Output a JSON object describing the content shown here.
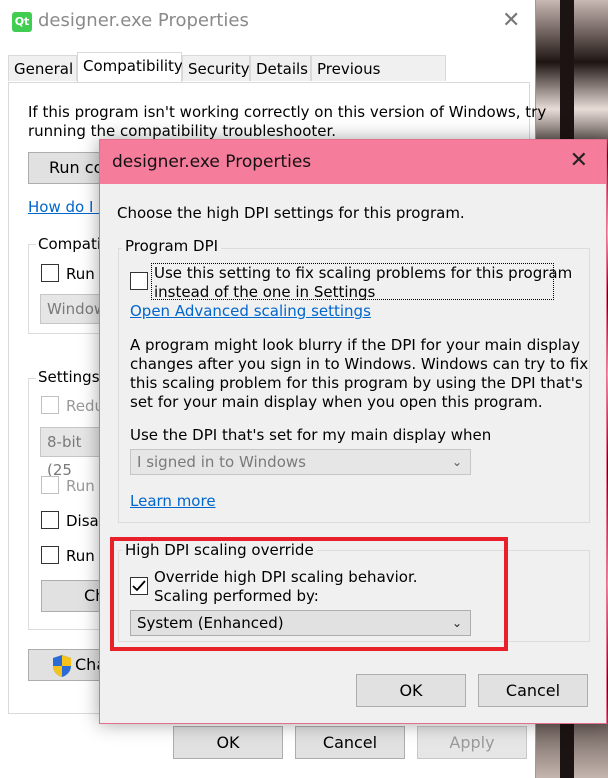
{
  "main_window": {
    "title": "designer.exe Properties",
    "icon_label": "Qt",
    "close_glyph": "✕",
    "tabs": [
      "General",
      "Compatibility",
      "Security",
      "Details",
      "Previous Versions"
    ],
    "intro_line1": "If this program isn't working correctly on this version of Windows, try",
    "intro_line2": "running the compatibility troubleshooter.",
    "run_button": "Run co",
    "how_link": "How do I c",
    "compat_group": "Compatib",
    "run_chk": "Run",
    "windows_combo": "Window",
    "settings_group": "Settings",
    "reduced_chk": "Redu",
    "color_combo": "8-bit (25",
    "run_chk2": "Run",
    "disable_chk": "Disal",
    "run_chk3": "Run",
    "change_btn": "Ch",
    "change_all_btn": "Cha",
    "ok": "OK",
    "cancel": "Cancel",
    "apply": "Apply"
  },
  "dialog": {
    "title": "designer.exe Properties",
    "close_glyph": "✕",
    "instruction": "Choose the high DPI settings for this program.",
    "program_dpi": {
      "legend": "Program DPI",
      "checkbox_line1": "Use this setting to fix scaling problems for this program",
      "checkbox_line2": "instead of the one in Settings",
      "checked": false,
      "link": "Open Advanced scaling settings",
      "para": [
        "A program might look blurry if the DPI for your main display",
        "changes after you sign in to Windows. Windows can try to fix",
        "this scaling problem for this program by using the DPI that's",
        "set for your main display when you open this program."
      ],
      "when_label": "Use the DPI that's set for my main display when",
      "when_value": "I signed in to Windows",
      "learn_more": "Learn more"
    },
    "override": {
      "legend": "High DPI scaling override",
      "checkbox_line1": "Override high DPI scaling behavior.",
      "checkbox_line2": "Scaling performed by:",
      "checked": true,
      "value": "System (Enhanced)"
    },
    "ok": "OK",
    "cancel": "Cancel",
    "highlight_color": "#e8202a",
    "titlebar_color": "#f67c9c"
  }
}
